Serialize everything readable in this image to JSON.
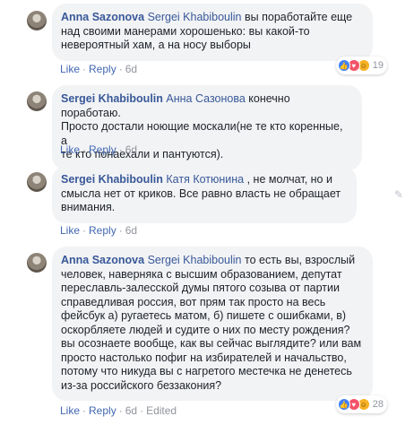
{
  "comments": [
    {
      "author": "Anna Sazonova",
      "mention": "Sergei Khabiboulin",
      "lines": [
        "вы поработайте еще",
        "над своими манерами хорошенько: вы какой-то",
        "невероятный хам, а на носу выборы"
      ],
      "like_label": "Like",
      "reply_label": "Reply",
      "time": "6d",
      "reaction_count": "19",
      "reactions": [
        "like",
        "love",
        "haha"
      ]
    },
    {
      "author": "Sergei Khabiboulin",
      "mention": "Анна Сазонова",
      "lines": [
        "конечно поработаю.",
        "Просто достали ноющие москали(не те кто коренные, а",
        "те кто понаехали и пантуются)."
      ],
      "like_label": "Like",
      "reply_label": "Reply",
      "time": "6d"
    },
    {
      "author": "Sergei Khabiboulin",
      "mention": "Катя Котюнина",
      "lines": [
        ", не молчат, но и",
        "смысла нет от криков. Все равно власть не обращает",
        "внимания."
      ],
      "like_label": "Like",
      "reply_label": "Reply",
      "time": "6d"
    },
    {
      "author": "Anna Sazonova",
      "mention": "Sergei Khabiboulin",
      "lines": [
        "то есть вы, взрослый",
        "человек, наверняка с высшим образованием, депутат",
        "переславль-залесской думы пятого созыва от партии",
        "справедливая россия, вот прям так просто на весь",
        "фейсбук а) ругаетесь матом, б) пишете с ошибками, в)",
        "оскорбляете людей и судите о них по месту рождения?",
        "вы осознаете вообще, как вы сейчас выглядите? или вам",
        "просто настолько пофиг на избирателей и начальство,",
        "потому что никуда вы с нагретого местечка не денетесь",
        "из-за российского беззакония?"
      ],
      "like_label": "Like",
      "reply_label": "Reply",
      "time": "6d",
      "edited_label": "Edited",
      "reaction_count": "28",
      "reactions": [
        "like",
        "love",
        "haha"
      ]
    }
  ]
}
